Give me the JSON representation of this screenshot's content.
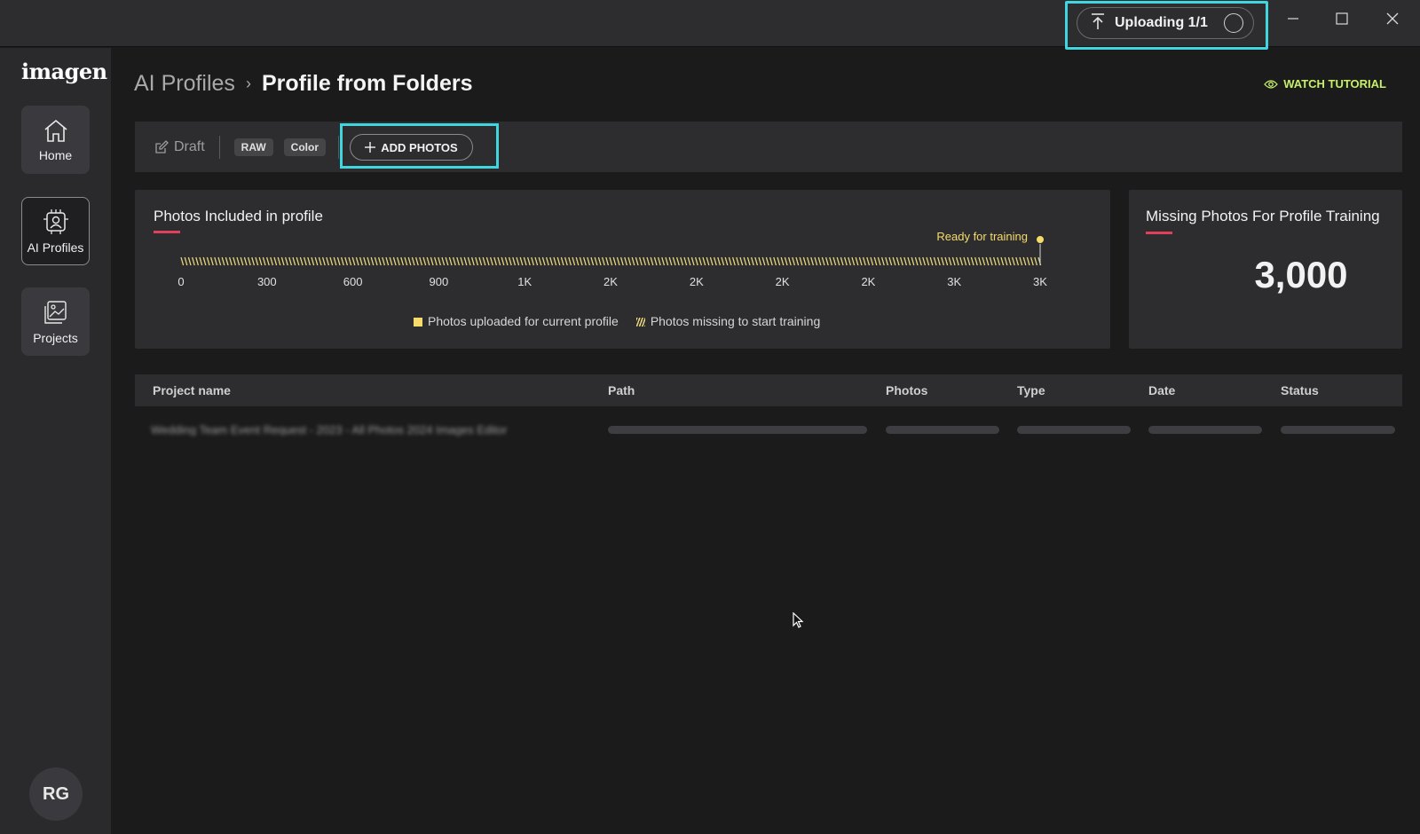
{
  "titlebar": {
    "upload_label": "Uploading 1/1",
    "controls": [
      "minimize",
      "maximize",
      "close"
    ]
  },
  "sidebar": {
    "logo": "imagen",
    "items": [
      {
        "label": "Home",
        "icon": "home-icon",
        "active": false
      },
      {
        "label": "AI Profiles",
        "icon": "ai-profile-icon",
        "active": true
      },
      {
        "label": "Projects",
        "icon": "projects-icon",
        "active": false
      }
    ],
    "avatar_initials": "RG"
  },
  "header": {
    "breadcrumb_parent": "AI Profiles",
    "breadcrumb_separator": "›",
    "title": "Profile from Folders",
    "watch_tutorial": "WATCH TUTORIAL"
  },
  "toolbar": {
    "status": "Draft",
    "tags": [
      "RAW",
      "Color"
    ],
    "add_photos": "ADD PHOTOS"
  },
  "photos_card": {
    "title": "Photos Included in profile",
    "ready_label": "Ready for training",
    "legend_uploaded": "Photos uploaded for current profile",
    "legend_missing": "Photos missing to start training"
  },
  "missing_card": {
    "title": "Missing Photos For Profile Training",
    "value": "3,000"
  },
  "chart_data": {
    "type": "bar",
    "orientation": "horizontal-progress",
    "tick_labels": [
      "0",
      "300",
      "600",
      "900",
      "1K",
      "2K",
      "2K",
      "2K",
      "2K",
      "3K",
      "3K"
    ],
    "uploaded": 0,
    "missing": 3000,
    "target": 3000,
    "series": [
      {
        "name": "Photos uploaded for current profile",
        "value": 0
      },
      {
        "name": "Photos missing to start training",
        "value": 3000
      }
    ],
    "colors": {
      "uploaded": "#f5dc6a",
      "missing": "#e8d77a"
    }
  },
  "table": {
    "columns": [
      "Project name",
      "Path",
      "Photos",
      "Type",
      "Date",
      "Status"
    ],
    "rows": [
      {
        "project_name": "Wedding Team Event Request - 2023 - All Photos 2024 Images Editor"
      }
    ]
  },
  "colors": {
    "accent_cyan": "#3fd6e0",
    "accent_red": "#e0405c",
    "accent_green": "#c6f06a",
    "ready_yellow": "#f5dc6a"
  }
}
